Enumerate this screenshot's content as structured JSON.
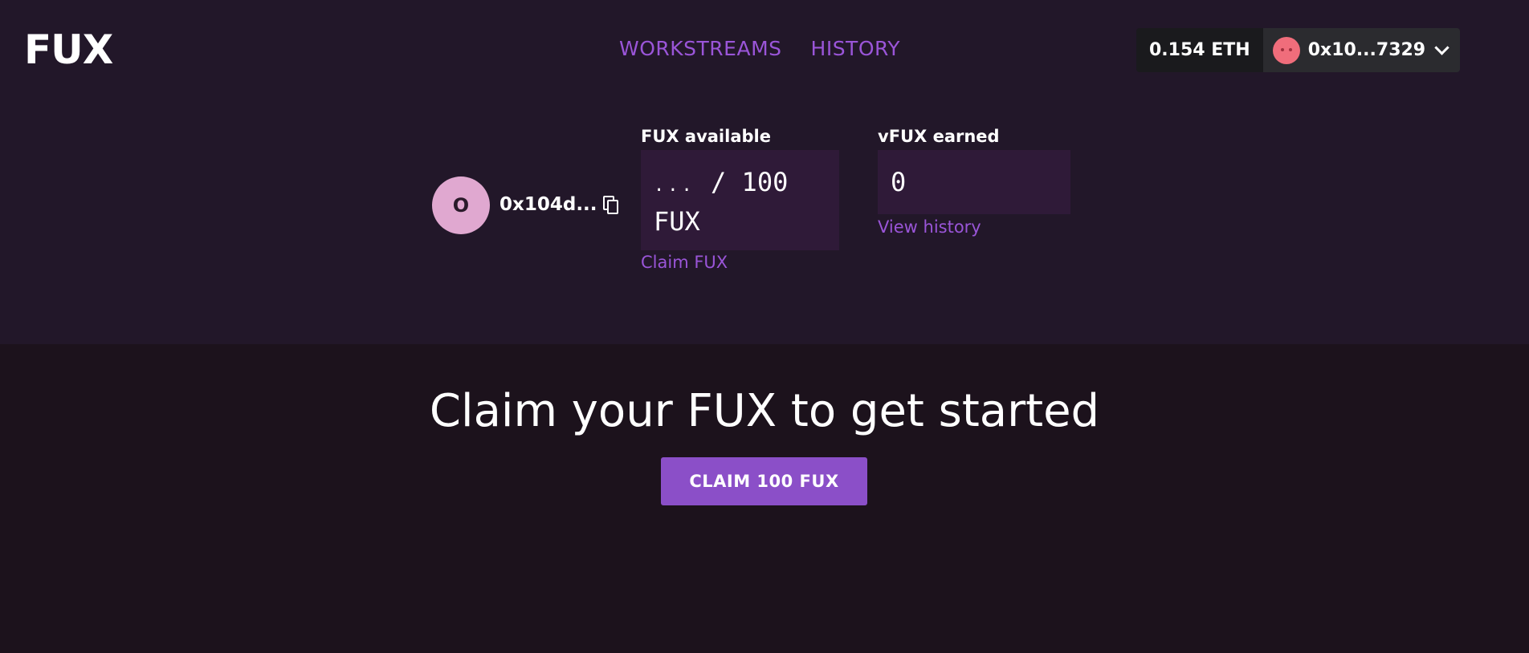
{
  "header": {
    "logo": "FUX",
    "nav": [
      {
        "label": "WORKSTREAMS"
      },
      {
        "label": "HISTORY"
      }
    ],
    "wallet": {
      "balance": "0.154 ETH",
      "account": "0x10...7329",
      "avatar_color": "#f06d7b"
    }
  },
  "profile": {
    "avatar_initial": "O",
    "address": "0x104d...",
    "copy_icon": "copy-icon"
  },
  "stats": {
    "fux_available": {
      "label": "FUX available",
      "value_prefix": "...",
      "value_suffix": "/ 100",
      "value_unit": "FUX",
      "link": "Claim FUX"
    },
    "vfux_earned": {
      "label": "vFUX earned",
      "value": "0",
      "link": "View history"
    }
  },
  "main": {
    "headline": "Claim your FUX to get started",
    "claim_button": "CLAIM 100 FUX"
  },
  "colors": {
    "accent": "#9a55d8",
    "button": "#8b4fc8",
    "top_bg": "#221729",
    "bottom_bg": "#1c121c"
  }
}
